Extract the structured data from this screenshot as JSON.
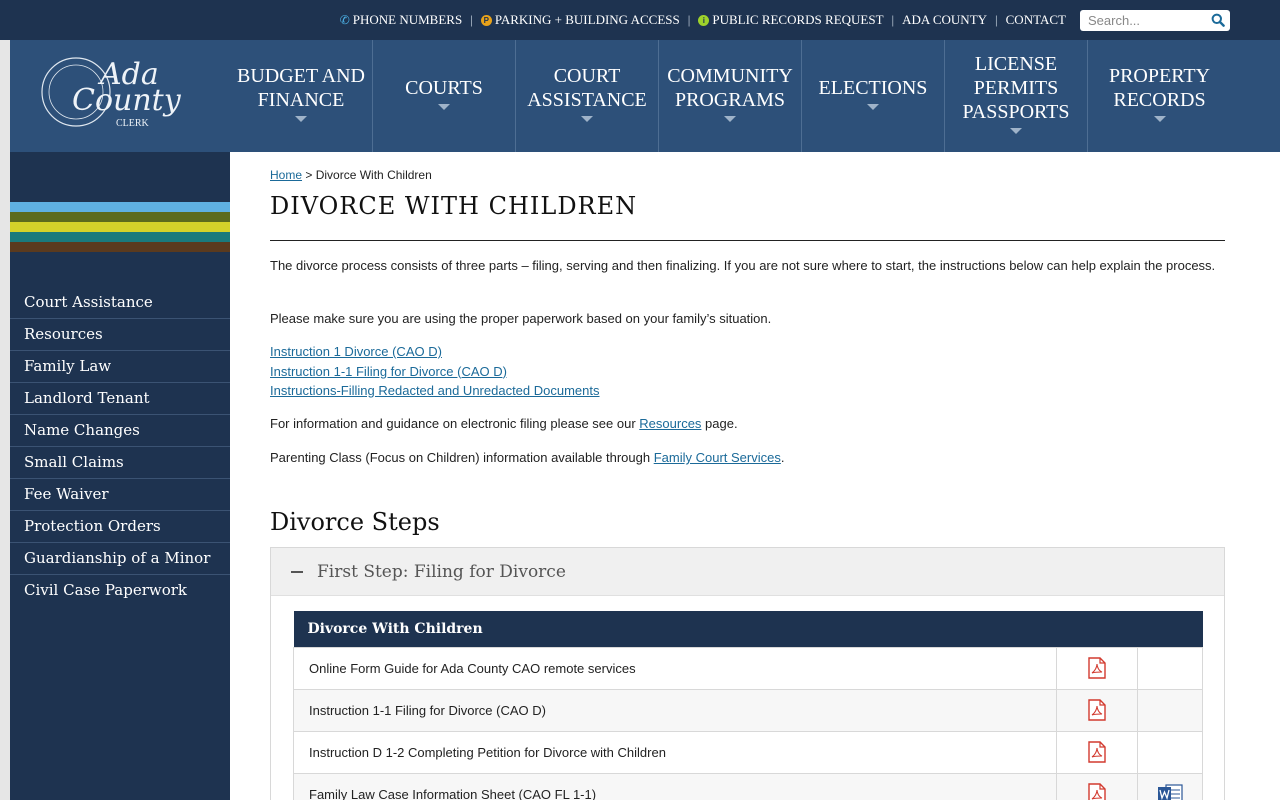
{
  "utility_nav": {
    "items": [
      {
        "label": "PHONE NUMBERS",
        "icon": "phone-icon"
      },
      {
        "label": "PARKING + BUILDING ACCESS",
        "icon": "parking-icon"
      },
      {
        "label": "PUBLIC RECORDS REQUEST",
        "icon": "info-icon"
      },
      {
        "label": "ADA COUNTY"
      },
      {
        "label": "CONTACT"
      }
    ],
    "search_placeholder": "Search..."
  },
  "logo": {
    "line1": "Ada",
    "line2": "County",
    "line3": "CLERK"
  },
  "main_nav": [
    {
      "line1": "BUDGET AND",
      "line2": "FINANCE"
    },
    {
      "line1": "COURTS"
    },
    {
      "line1": "COURT",
      "line2": "ASSISTANCE"
    },
    {
      "line1": "COMMUNITY",
      "line2": "PROGRAMS"
    },
    {
      "line1": "ELECTIONS"
    },
    {
      "line1": "LICENSE",
      "line2": "PERMITS",
      "line3": "PASSPORTS"
    },
    {
      "line1": "PROPERTY",
      "line2": "RECORDS"
    }
  ],
  "stripe_colors": [
    "#5fb1e2",
    "#5c6b1d",
    "#d4d22a",
    "#1a7a7c",
    "#5a3a1e"
  ],
  "side_nav": [
    "Court Assistance",
    "Resources",
    "Family Law",
    "Landlord Tenant",
    "Name Changes",
    "Small Claims",
    "Fee Waiver",
    "Protection Orders",
    "Guardianship of a Minor",
    "Civil Case Paperwork"
  ],
  "breadcrumb": {
    "home": "Home",
    "separator": ">",
    "current": "Divorce With Children"
  },
  "page_title": "DIVORCE WITH CHILDREN",
  "intro": "The divorce process consists of three parts – filing, serving and then finalizing. If you are not sure where to start, the instructions below can help explain the process.",
  "paperwork_note": "Please make sure you are using the proper paperwork based on your family’s situation.",
  "instruction_links": [
    "Instruction 1 Divorce (CAO D)",
    "Instruction 1-1 Filing for Divorce (CAO D)",
    "Instructions-Filling Redacted and Unredacted Documents"
  ],
  "efiling": {
    "before": "For information and guidance on electronic filing please see our ",
    "link": "Resources",
    "after": " page."
  },
  "parenting": {
    "before": "Parenting Class (Focus on Children) information available through ",
    "link": "Family Court Services",
    "after": "."
  },
  "section_heading": "Divorce Steps",
  "accordion": {
    "title": "First Step: Filing for Divorce"
  },
  "table": {
    "header": "Divorce With Children",
    "rows": [
      {
        "name": "Online Form Guide for Ada County CAO remote services",
        "pdf": true,
        "word": false
      },
      {
        "name": "Instruction 1-1 Filing for Divorce (CAO D)",
        "pdf": true,
        "word": false
      },
      {
        "name": "Instruction D 1-2 Completing Petition for Divorce with Children",
        "pdf": true,
        "word": false
      },
      {
        "name": "Family Law Case Information Sheet (CAO FL 1-1)",
        "pdf": true,
        "word": true
      }
    ]
  }
}
